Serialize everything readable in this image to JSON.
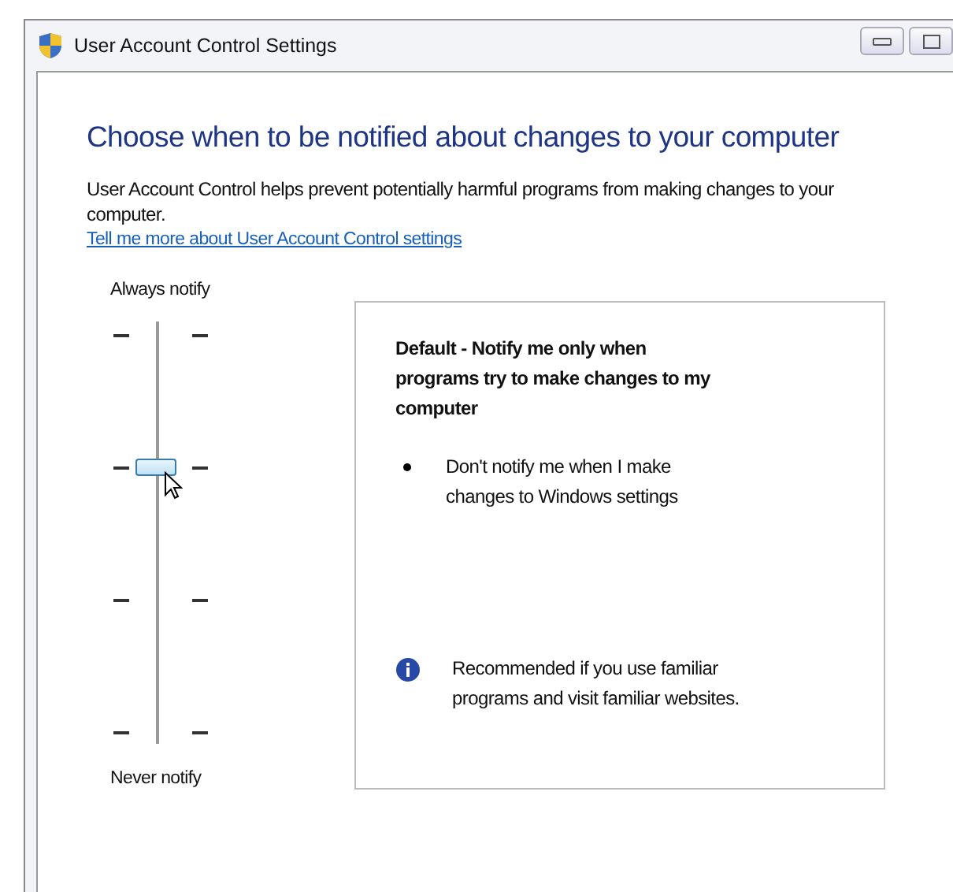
{
  "window": {
    "title": "User Account Control Settings"
  },
  "heading": "Choose when to be notified about changes to your computer",
  "description": "User Account Control helps prevent potentially harmful programs from making changes to your computer.",
  "link": "Tell me more about User Account Control settings",
  "slider": {
    "top_label": "Always notify",
    "bottom_label": "Never notify",
    "level": 0.667
  },
  "info": {
    "title": "Default - Notify me only when programs try to make changes to my computer",
    "bullets": [
      "Don't notify me when I make changes to Windows settings"
    ],
    "note": "Recommended if you use familiar programs and visit familiar websites."
  }
}
